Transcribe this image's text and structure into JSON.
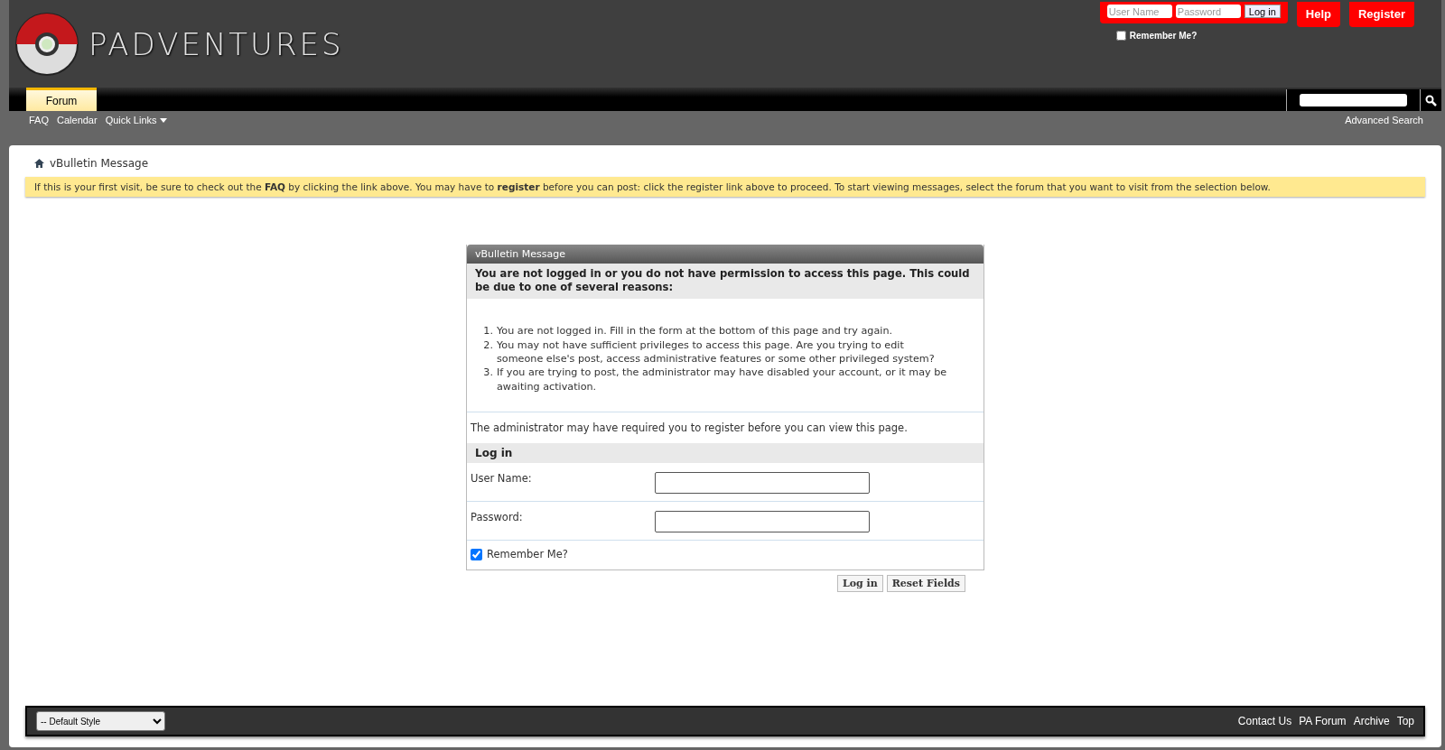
{
  "header": {
    "logo_text": "PADVENTURES",
    "login": {
      "username_placeholder": "User Name",
      "password_placeholder": "Password",
      "button": "Log in",
      "remember_label": "Remember Me?",
      "remember_checked": false
    },
    "buttons": [
      "Help",
      "Register"
    ]
  },
  "navbar": {
    "tabs": [
      {
        "label": "Forum",
        "selected": true
      }
    ]
  },
  "subnav": {
    "links": [
      "FAQ",
      "Calendar",
      "Quick Links"
    ],
    "advanced_search": "Advanced Search"
  },
  "breadcrumb": "vBulletin Message",
  "notice": "If this is your first visit, be sure to check out the **FAQ** by clicking the link above. You may have to **register** before you can post: click the register link above to proceed. To start viewing messages, select the forum that you want to visit from the selection below.",
  "message": {
    "title": "vBulletin Message",
    "heading": "You are not logged in or you do not have permission to access this page. This could be due to one of several reasons:",
    "reasons": [
      {
        "marker": "1.",
        "text": "You are not logged in. Fill in the form at the bottom of this page and try again."
      },
      {
        "marker": "2.",
        "text": "You may not have sufficient privileges to access this page. Are you trying to edit someone else's post, access administrative features or some other privileged system?"
      },
      {
        "marker": "3.",
        "text": "If you are trying to post, the administrator may have disabled your account, or it may be awaiting activation."
      }
    ],
    "note": "The administrator may have required you to register before you can view this page.",
    "login_heading": "Log in",
    "fields": [
      "User Name:",
      "Password:"
    ],
    "remember_label": "Remember Me?",
    "remember_checked": true,
    "buttons": [
      "Log in",
      "Reset Fields"
    ]
  },
  "footer": {
    "style_select": "-- Default Style",
    "links": [
      "Contact Us",
      "PA Forum",
      "Archive",
      "Top"
    ]
  }
}
